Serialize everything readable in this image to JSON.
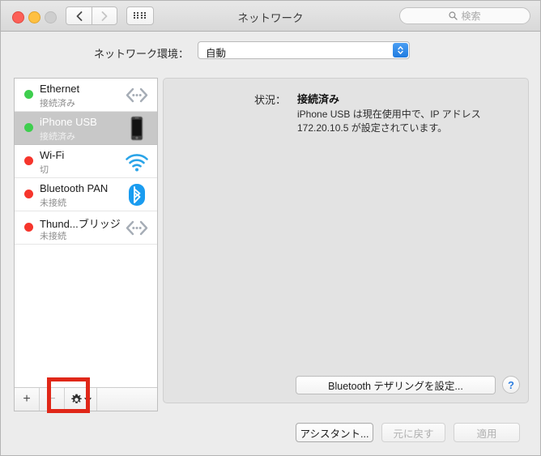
{
  "window": {
    "title": "ネットワーク",
    "traffic_lights": [
      "close",
      "minimize",
      "zoom"
    ],
    "nav": {
      "back": "back-chevron",
      "forward": "forward-chevron",
      "grid": "show-all-grid"
    },
    "search": {
      "placeholder": "検索",
      "icon": "search-icon"
    }
  },
  "location": {
    "label": "ネットワーク環境：",
    "value": "自動"
  },
  "services": [
    {
      "name": "Ethernet",
      "status": "接続済み",
      "dot": "green",
      "icon": "ethernet-icon",
      "selected": false
    },
    {
      "name": "iPhone USB",
      "status": "接続済み",
      "dot": "green",
      "icon": "iphone-icon",
      "selected": true
    },
    {
      "name": "Wi-Fi",
      "status": "切",
      "dot": "red",
      "icon": "wifi-icon",
      "selected": false
    },
    {
      "name": "Bluetooth PAN",
      "status": "未接続",
      "dot": "red",
      "icon": "bluetooth-icon",
      "selected": false
    },
    {
      "name": "Thund...ブリッジ",
      "status": "未接続",
      "dot": "red",
      "icon": "ethernet-icon",
      "selected": false
    }
  ],
  "list_toolbar": {
    "add_label": "+",
    "remove_label": "−",
    "gear_icon": "gear-icon",
    "gear_chevron": "chevron-down-icon"
  },
  "detail": {
    "status_label": "状況：",
    "status_value": "接続済み",
    "status_description": "iPhone USB は現在使用中で、IP アドレス 172.20.10.5 が設定されています。"
  },
  "buttons": {
    "tethering": "Bluetooth テザリングを設定...",
    "help": "?",
    "assistant": "アシスタント...",
    "revert": "元に戻す",
    "apply": "適用"
  },
  "annotation": {
    "shape": "rectangle",
    "color": "#e02718",
    "target": "gear-action-button"
  }
}
